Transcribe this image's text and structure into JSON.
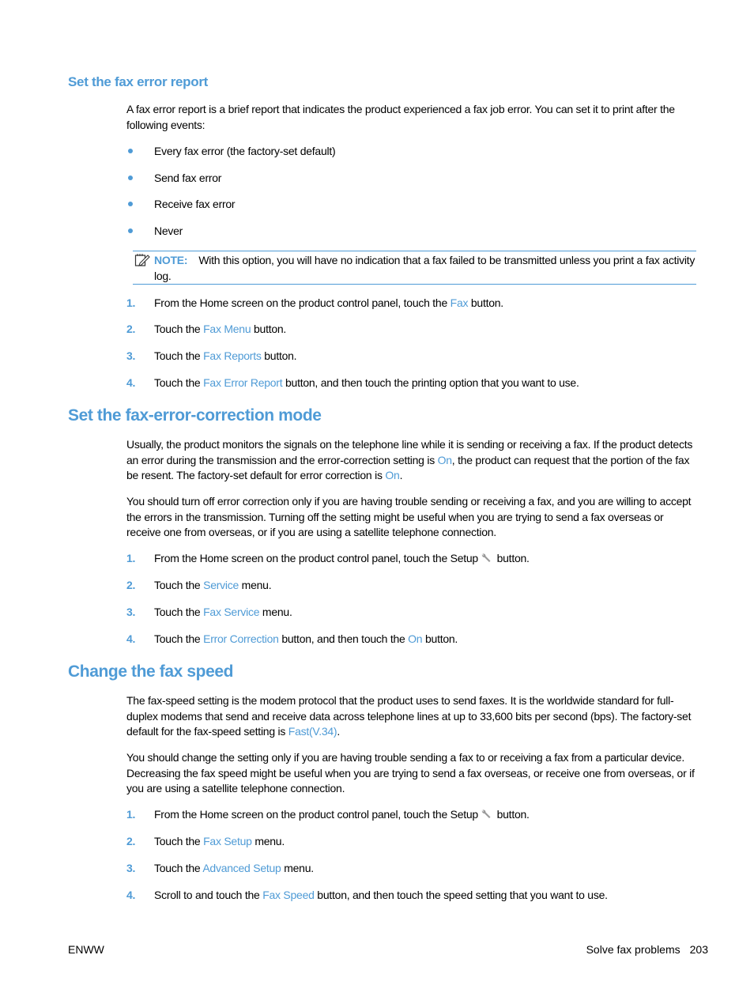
{
  "colors": {
    "accent": "#4f9bd6",
    "text": "#000000"
  },
  "section1": {
    "heading": "Set the fax error report",
    "intro": "A fax error report is a brief report that indicates the product experienced a fax job error. You can set it to print after the following events:",
    "bullets": [
      "Every fax error (the factory-set default)",
      "Send fax error",
      "Receive fax error",
      "Never"
    ],
    "note": {
      "icon": "note-pencil-icon",
      "label": "NOTE:",
      "text": "With this option, you will have no indication that a fax failed to be transmitted unless you print a fax activity log."
    },
    "steps": [
      {
        "num": "1.",
        "pre": "From the Home screen on the product control panel, touch the ",
        "link": "Fax",
        "post": " button."
      },
      {
        "num": "2.",
        "pre": "Touch the ",
        "link": "Fax Menu",
        "post": " button."
      },
      {
        "num": "3.",
        "pre": "Touch the ",
        "link": "Fax Reports",
        "post": " button."
      },
      {
        "num": "4.",
        "pre": "Touch the ",
        "link": "Fax Error Report",
        "post": " button, and then touch the printing option that you want to use."
      }
    ]
  },
  "section2": {
    "heading": "Set the fax-error-correction mode",
    "para1": {
      "a": "Usually, the product monitors the signals on the telephone line while it is sending or receiving a fax. If the product detects an error during the transmission and the error-correction setting is ",
      "link1": "On",
      "b": ", the product can request that the portion of the fax be resent. The factory-set default for error correction is ",
      "link2": "On",
      "c": "."
    },
    "para2": "You should turn off error correction only if you are having trouble sending or receiving a fax, and you are willing to accept the errors in the transmission. Turning off the setting might be useful when you are trying to send a fax overseas or receive one from overseas, or if you are using a satellite telephone connection.",
    "steps": [
      {
        "num": "1.",
        "pre": "From the Home screen on the product control panel, touch the Setup",
        "icon": "wrench-icon",
        "post": " button."
      },
      {
        "num": "2.",
        "pre": "Touch the ",
        "link": "Service",
        "post": " menu."
      },
      {
        "num": "3.",
        "pre": "Touch the ",
        "link": "Fax Service",
        "post": " menu."
      },
      {
        "num": "4.",
        "pre": "Touch the ",
        "link": "Error Correction",
        "mid": " button, and then touch the ",
        "link2": "On",
        "post": " button."
      }
    ]
  },
  "section3": {
    "heading": "Change the fax speed",
    "para1": {
      "a": "The fax-speed setting is the modem protocol that the product uses to send faxes. It is the worldwide standard for full-duplex modems that send and receive data across telephone lines at up to 33,600 bits per second (bps). The factory-set default for the fax-speed setting is ",
      "link": "Fast(V.34)",
      "b": "."
    },
    "para2": "You should change the setting only if you are having trouble sending a fax to or receiving a fax from a particular device. Decreasing the fax speed might be useful when you are trying to send a fax overseas, or receive one from overseas, or if you are using a satellite telephone connection.",
    "steps": [
      {
        "num": "1.",
        "pre": "From the Home screen on the product control panel, touch the Setup",
        "icon": "wrench-icon",
        "post": " button."
      },
      {
        "num": "2.",
        "pre": "Touch the ",
        "link": "Fax Setup",
        "post": " menu."
      },
      {
        "num": "3.",
        "pre": "Touch the ",
        "link": "Advanced Setup",
        "post": " menu."
      },
      {
        "num": "4.",
        "pre": "Scroll to and touch the ",
        "link": "Fax Speed",
        "post": " button, and then touch the speed setting that you want to use."
      }
    ]
  },
  "footer": {
    "left": "ENWW",
    "section": "Solve fax problems",
    "page": "203"
  }
}
